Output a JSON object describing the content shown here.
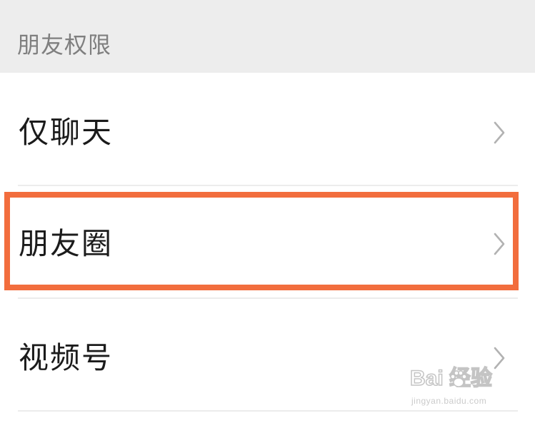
{
  "section": {
    "title": "朋友权限"
  },
  "rows": [
    {
      "label": "仅聊天",
      "icon": "chevron-right-icon"
    },
    {
      "label": "朋友圈",
      "icon": "chevron-right-icon",
      "highlighted": true
    },
    {
      "label": "视频号",
      "icon": "chevron-right-icon"
    }
  ],
  "highlight": {
    "color": "#f26d3d"
  },
  "watermark": {
    "brand": "Bai  经验",
    "url": "jingyan.baidu.com",
    "icon": "paw-icon"
  }
}
